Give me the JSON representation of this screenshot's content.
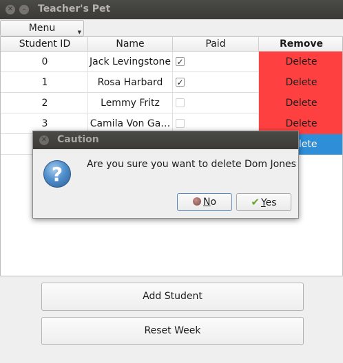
{
  "window": {
    "title": "Teacher's Pet"
  },
  "menu": {
    "label": "Menu"
  },
  "table": {
    "headers": [
      "Student ID",
      "Name",
      "Paid",
      "Remove"
    ],
    "rows": [
      {
        "id": "0",
        "name": "Jack Levingstone",
        "paid": true,
        "action": "Delete"
      },
      {
        "id": "1",
        "name": "Rosa Harbard",
        "paid": true,
        "action": "Delete"
      },
      {
        "id": "2",
        "name": "Lemmy Fritz",
        "paid": false,
        "action": "Delete"
      },
      {
        "id": "3",
        "name": "Camila Von Ga…",
        "paid": false,
        "action": "Delete"
      },
      {
        "id": "",
        "name": "",
        "paid": false,
        "action": "Delete"
      }
    ],
    "check_mark": "✓"
  },
  "buttons": {
    "add_student": "Add Student",
    "reset_week": "Reset Week"
  },
  "dialog": {
    "title": "Caution",
    "icon_glyph": "?",
    "message": "Are you sure you want to delete Dom Jones",
    "no_label": "No",
    "yes_label": "Yes",
    "no_first": "N",
    "no_rest": "o",
    "yes_first": "Y",
    "yes_rest": "es"
  },
  "colors": {
    "delete_bg": "#ff4040",
    "selected_bg": "#2f8ed8",
    "titlebar_bg": "#3c3b37"
  }
}
